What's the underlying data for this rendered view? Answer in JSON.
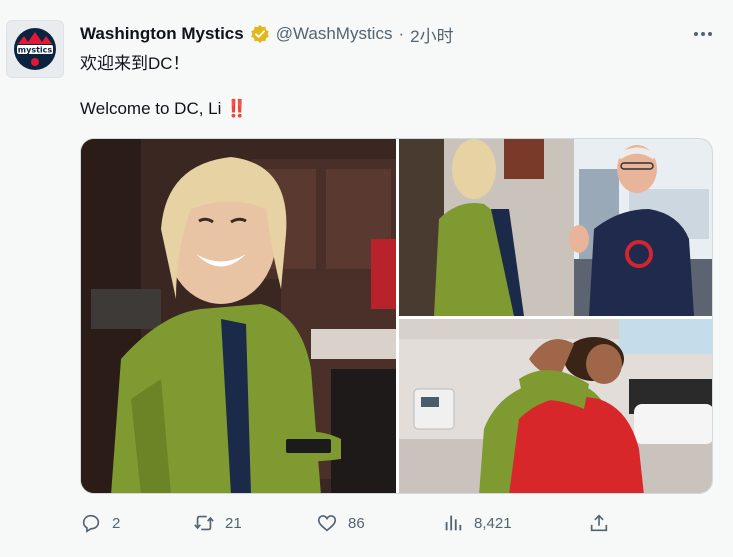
{
  "tweet": {
    "author_name": "Washington Mystics",
    "handle": "@WashMystics",
    "separator": "·",
    "time": "2小时",
    "line1": "欢迎来到DC！",
    "line2": "Welcome to DC, Li",
    "emoji": "‼️",
    "avatar_label": "mystics",
    "verified_color": "#e2b719"
  },
  "metrics": {
    "replies": "2",
    "retweets": "21",
    "likes": "86",
    "views": "8,421"
  },
  "icons": {
    "reply": "reply-icon",
    "retweet": "retweet-icon",
    "like": "heart-icon",
    "views": "views-icon",
    "share": "share-icon",
    "more": "more-icon"
  }
}
